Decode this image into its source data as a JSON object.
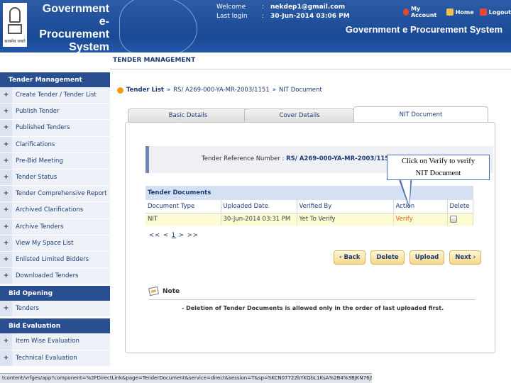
{
  "header": {
    "brand_line1": "Government",
    "brand_line2": "e-Procurement",
    "brand_line3": "System",
    "emblem_caption": "सत्यमेव जयते",
    "welcome_label": "Welcome",
    "welcome_value": "nekdep1@gmail.com",
    "lastlogin_label": "Last login",
    "lastlogin_value": "30-Jun-2014 03:06 PM",
    "colon": ":",
    "links": {
      "my_account": "My Account",
      "home": "Home",
      "logout": "Logout"
    },
    "system_title": "Government e Procurement System",
    "colors": {
      "bar": "#1a4a96",
      "account_icon": "#e04a2a",
      "home_icon": "#f2c04a",
      "logout_icon": "#e5483b"
    }
  },
  "section_title": "TENDER MANAGEMENT",
  "sidebar": {
    "sections": [
      {
        "title": "Tender Management",
        "items": [
          "Create Tender / Tender List",
          "Publish Tender",
          "Published Tenders",
          "Clarifications",
          "Pre-Bid Meeting",
          "Tender Status",
          "Tender Comprehensive Report",
          "Archived Clarifications",
          "Archive Tenders",
          "View My Space List",
          "Enlisted Limited Bidders",
          "Downloaded Tenders"
        ]
      },
      {
        "title": "Bid Opening",
        "items": [
          "Tenders"
        ]
      },
      {
        "title": "Bid Evaluation",
        "items": [
          "Item Wise Evaluation",
          "Technical Evaluation"
        ]
      }
    ],
    "expand_symbol": "+"
  },
  "breadcrumb": {
    "root": "Tender List",
    "sep": "»",
    "ref": "RS/ A269-000-YA-MR-2003/1151",
    "current": "NIT Document"
  },
  "tabs": [
    "Basic Details",
    "Cover Details",
    "NIT Document"
  ],
  "reference": {
    "label": "Tender Reference Number :",
    "value": "RS/ A269-000-YA-MR-2003/1151"
  },
  "documents": {
    "title": "Tender Documents",
    "columns": [
      "Document Type",
      "Uploaded Date",
      "Verified By",
      "Action",
      "Delete"
    ],
    "rows": [
      {
        "type": "NIT",
        "date": "30-Jun-2014 03:31 PM",
        "verified": "Yet To Verify",
        "action": "Verify"
      }
    ],
    "pager": {
      "prev": "<< <",
      "page": "1",
      "next": "> >>"
    }
  },
  "buttons": {
    "back": "‹ Back",
    "delete": "Delete",
    "upload": "Upload",
    "next": "Next ›"
  },
  "note": {
    "title": "Note",
    "message": "- Deletion of Tender Documents is allowed only in the order of last uploaded first."
  },
  "callout": {
    "line1": "Click on Verify to verify",
    "line2": "NIT Document"
  },
  "statusbar": "tcontent/vrfges/app?component=%2FDirectLink&page=TenderDocument&service=direct&session=T&sp=SKCN07722bYKQbL1KsA%2B4%3BJKN76JSKFvyyfjW0NEP%3D"
}
